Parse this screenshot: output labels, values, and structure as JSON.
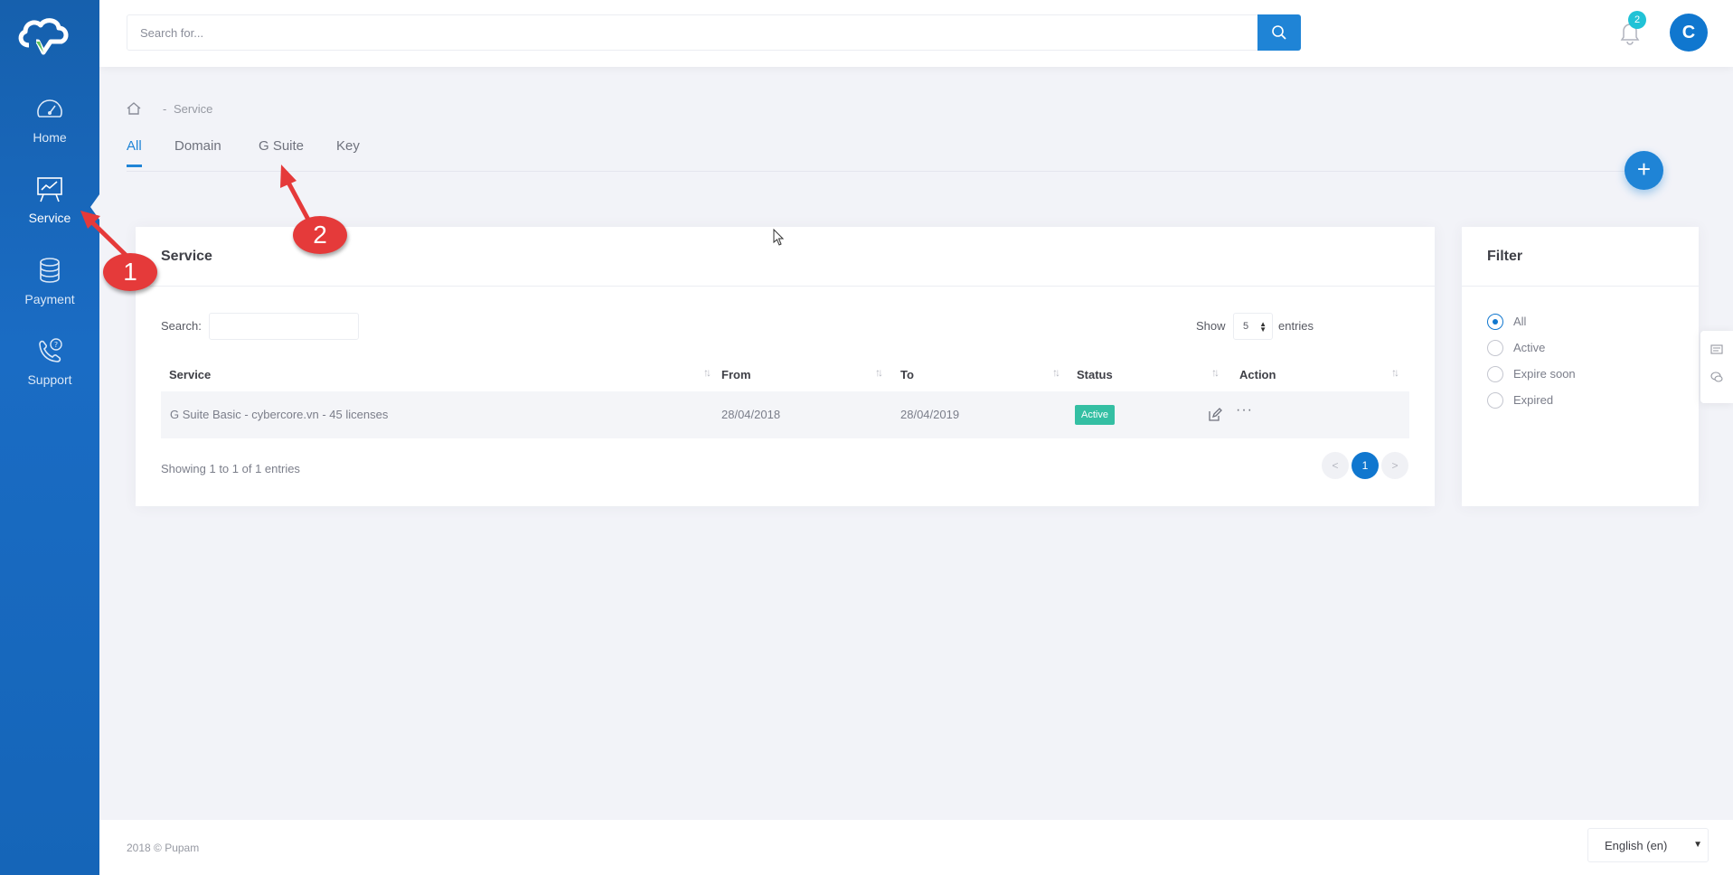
{
  "sidebar": {
    "items": [
      {
        "label": "Home",
        "icon": "speedometer-icon"
      },
      {
        "label": "Service",
        "icon": "presentation-chart-icon"
      },
      {
        "label": "Payment",
        "icon": "coins-icon"
      },
      {
        "label": "Support",
        "icon": "phone-help-icon"
      }
    ],
    "active": "Service"
  },
  "header": {
    "search_placeholder": "Search for...",
    "notification_count": "2",
    "avatar_initial": "C"
  },
  "breadcrumb": {
    "separator": "-",
    "current": "Service"
  },
  "tabs": [
    "All",
    "Domain",
    "G Suite",
    "Key"
  ],
  "active_tab": "All",
  "fab_label": "+",
  "service_panel": {
    "title": "Service",
    "search_label": "Search:",
    "show_label": "Show",
    "entries_value": "5",
    "entries_label": "entries",
    "columns": [
      "Service",
      "From",
      "To",
      "Status",
      "Action"
    ],
    "rows": [
      {
        "service": "G Suite Basic - cybercore.vn - 45 licenses",
        "from": "28/04/2018",
        "to": "28/04/2019",
        "status": "Active",
        "more": "···"
      }
    ],
    "info": "Showing 1 to 1 of 1 entries",
    "pagination": {
      "prev": "<",
      "current": "1",
      "next": ">"
    }
  },
  "filter_panel": {
    "title": "Filter",
    "options": [
      "All",
      "Active",
      "Expire soon",
      "Expired"
    ],
    "selected": "All"
  },
  "footer": {
    "copyright": "2018 © Pupam",
    "language": "English (en)"
  },
  "annotations": [
    "1",
    "2"
  ],
  "colors": {
    "primary": "#1077cf",
    "sidebar": "#1a6cc4",
    "success": "#34bfa3",
    "badge": "#21c2d6",
    "annotation": "#e53a3a"
  }
}
